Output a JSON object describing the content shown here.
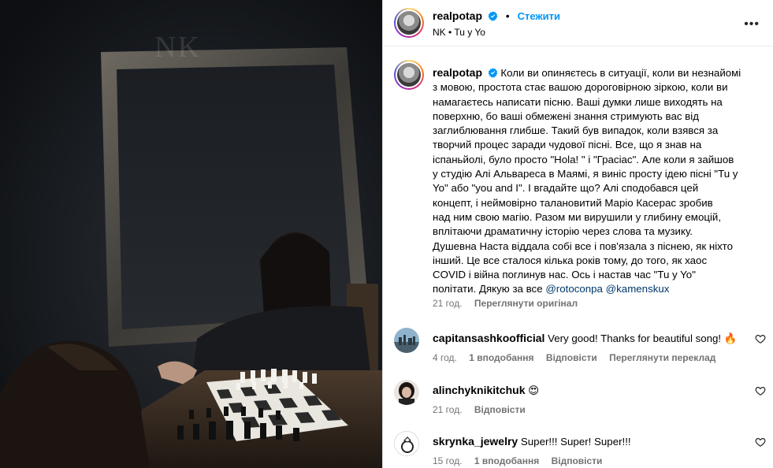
{
  "post": {
    "media": {
      "watermark": "NK"
    },
    "header": {
      "username": "realpotap",
      "follow_label": "Стежити",
      "dot": "•",
      "subtitle": "NK • Tu y Yo",
      "more": "•••"
    },
    "caption": {
      "username": "realpotap",
      "lines": [
        "Коли ви опиняєтесь в ситуації, коли ви незнайомі",
        "з мовою, простота стає вашою дороговірною зіркою, коли ви",
        "намагаєтесь написати пісню. Ваші думки лише виходять на",
        "поверхню, бо ваші обмежені знання стримують вас від",
        "заглиблювання глибше. Такий був випадок, коли взявся за",
        "творчий процес заради чудової пісні. Все, що я знав на",
        "іспаньйолі, було просто \"Hola! \" і \"Грасіас\". Але коли я зайшов",
        "у студію Алі Альвареса в Маямі, я виніс просту ідею пісні \"Tu y",
        "Yo\" або \"you and I\". І вгадайте що? Алі сподобався цей",
        "концепт, і неймовірно талановитий Маріо Касерас зробив",
        "над ним свою магію. Разом ми вирушили у глибину емоцій,",
        "вплітаючи драматичну історію через слова та музику.",
        "Душевна Наста віддала собі все і пов'язала з піснею, як ніхто",
        "інший. Це все сталося кілька років тому, до того, як хаос",
        "COVID і війна поглинув нас. Ось і настав час \"Tu y Yo\""
      ],
      "last_line_text": "політати. Дякую за все",
      "mention_1": "@rotoconpa",
      "mention_2": "@kamenskux",
      "time": "21 год.",
      "see_original": "Переглянути оригінал"
    },
    "comments": [
      {
        "username": "capitansashkoofficial",
        "text": "Very good! Thanks for beautiful song! 🔥",
        "time": "4 год.",
        "likes": "1 вподобання",
        "reply": "Відповісти",
        "translate": "Переглянути переклад"
      },
      {
        "username": "alinchyknikitchuk",
        "text": "😍",
        "time": "21 год.",
        "reply": "Відповісти"
      },
      {
        "username": "skrynka_jewelry",
        "text": "Super!!! Super! Super!!!",
        "time": "15 год.",
        "likes": "1 вподобання",
        "reply": "Відповісти"
      }
    ]
  },
  "colors": {
    "link_blue": "#0095f6",
    "mention_blue": "#00376b",
    "meta_gray": "#737373",
    "verified_blue": "#0095f6"
  }
}
